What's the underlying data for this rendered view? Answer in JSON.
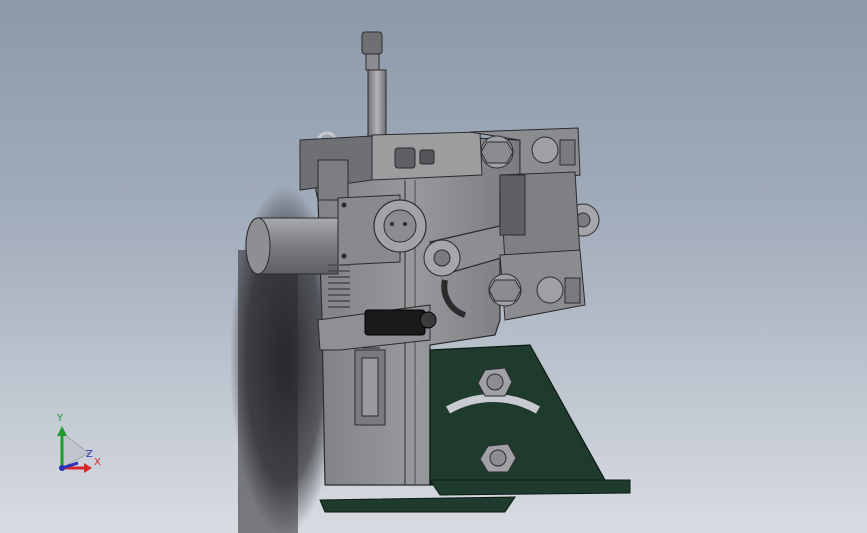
{
  "viewport": {
    "background_top": "#8c99ab",
    "background_bottom": "#d8dce2"
  },
  "model": {
    "body_color": "#8a8a8c",
    "bracket_color": "#1f3b2e",
    "shadow_color": "#2a2a2e"
  },
  "triad": {
    "y_label": "Y",
    "x_label": "X",
    "z_label": "Z",
    "y_color": "#1f9a2f",
    "x_color": "#d8262c",
    "z_color": "#2a2fb8"
  }
}
